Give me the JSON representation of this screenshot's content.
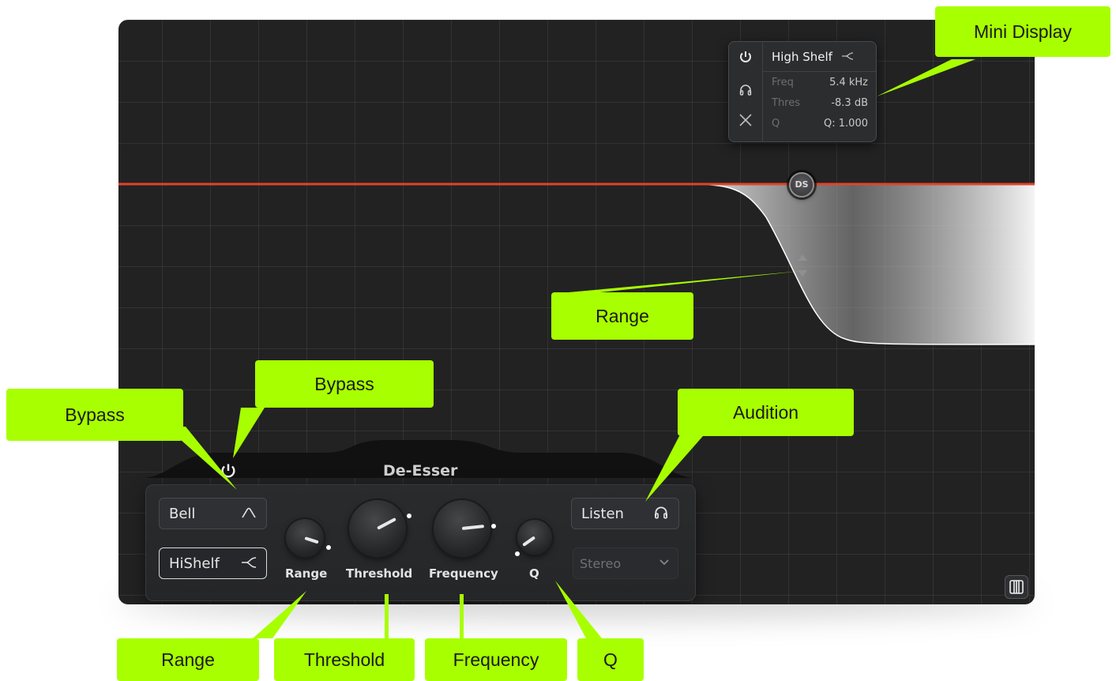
{
  "mini_display": {
    "filter_type": "High Shelf",
    "freq_label": "Freq",
    "freq_value": "5.4 kHz",
    "thres_label": "Thres",
    "thres_value": "-8.3 dB",
    "q_label": "Q",
    "q_value": "Q: 1.000",
    "icons": [
      "power-icon",
      "headphones-icon",
      "close-icon"
    ]
  },
  "band_handle": {
    "label": "DS"
  },
  "panel": {
    "band_name": "De-Esser",
    "bell_label": "Bell",
    "hishelf_label": "HiShelf",
    "listen_label": "Listen",
    "stereo_label": "Stereo",
    "knobs": {
      "range_label": "Range",
      "threshold_label": "Threshold",
      "frequency_label": "Frequency",
      "q_label": "Q"
    }
  },
  "callouts": {
    "mini_display": "Mini Display",
    "range_handle": "Range",
    "bypass_top": "Bypass",
    "bypass_left": "Bypass",
    "audition": "Audition",
    "range": "Range",
    "threshold": "Threshold",
    "frequency": "Frequency",
    "q": "Q"
  },
  "colors": {
    "accent_red": "#e2432a",
    "callout_green": "#a8ff00",
    "background": "#222223"
  }
}
